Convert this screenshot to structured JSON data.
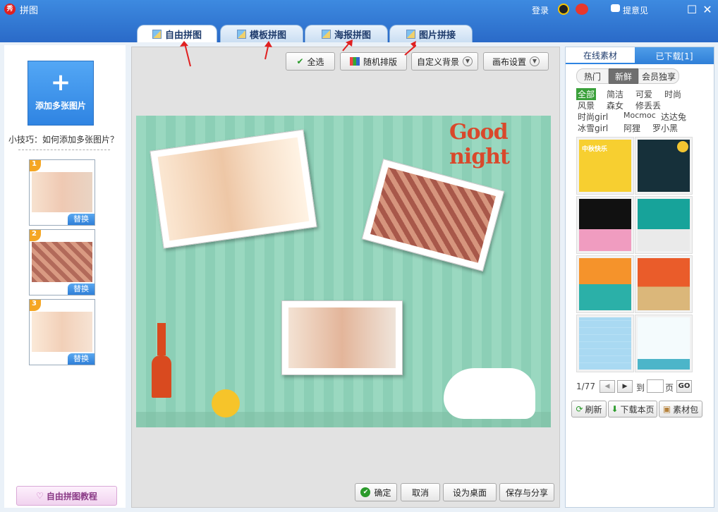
{
  "window": {
    "title": "拼图",
    "logo_text": "秀",
    "login": "登录",
    "feedback": "提意见"
  },
  "tabs": [
    {
      "label": "自由拼图",
      "active": true
    },
    {
      "label": "模板拼图",
      "active": false
    },
    {
      "label": "海报拼图",
      "active": false
    },
    {
      "label": "图片拼接",
      "active": false
    }
  ],
  "left": {
    "add_button": "添加多张图片",
    "tip": "小技巧：如何添加多张图片？",
    "thumbs": [
      {
        "num": "1",
        "replace": "替换"
      },
      {
        "num": "2",
        "replace": "替换"
      },
      {
        "num": "3",
        "replace": "替换"
      }
    ],
    "tutorial": "自由拼图教程"
  },
  "toolbar": {
    "select_all": "全选",
    "random": "随机排版",
    "bg": "自定义背景",
    "canvas": "画布设置"
  },
  "canvas": {
    "headline": "Good night"
  },
  "bottom": {
    "confirm": "确定",
    "cancel": "取消",
    "desktop": "设为桌面",
    "save": "保存与分享"
  },
  "right": {
    "tabs": [
      "在线素材",
      "已下载[1]"
    ],
    "filters": [
      "热门",
      "新鲜",
      "会员独享"
    ],
    "active_filter": "新鲜",
    "categories": [
      [
        "全部",
        "简洁",
        "可爱",
        "时尚"
      ],
      [
        "风景",
        "森女",
        "修丢丢"
      ],
      [
        "时尚girl",
        "Mocmoc",
        "达达兔"
      ],
      [
        "冰雪girl",
        "阿狸",
        "罗小黑"
      ]
    ],
    "cell_caption": "中秋快乐",
    "pager": {
      "page": "1/77",
      "goto": "到",
      "unit": "页",
      "go": "GO"
    },
    "actions": [
      "刷新",
      "下载本页",
      "素材包"
    ]
  },
  "colors": {
    "accent": "#2f84e2",
    "canvas": "#9ad8c0",
    "headline": "#d9482b"
  }
}
